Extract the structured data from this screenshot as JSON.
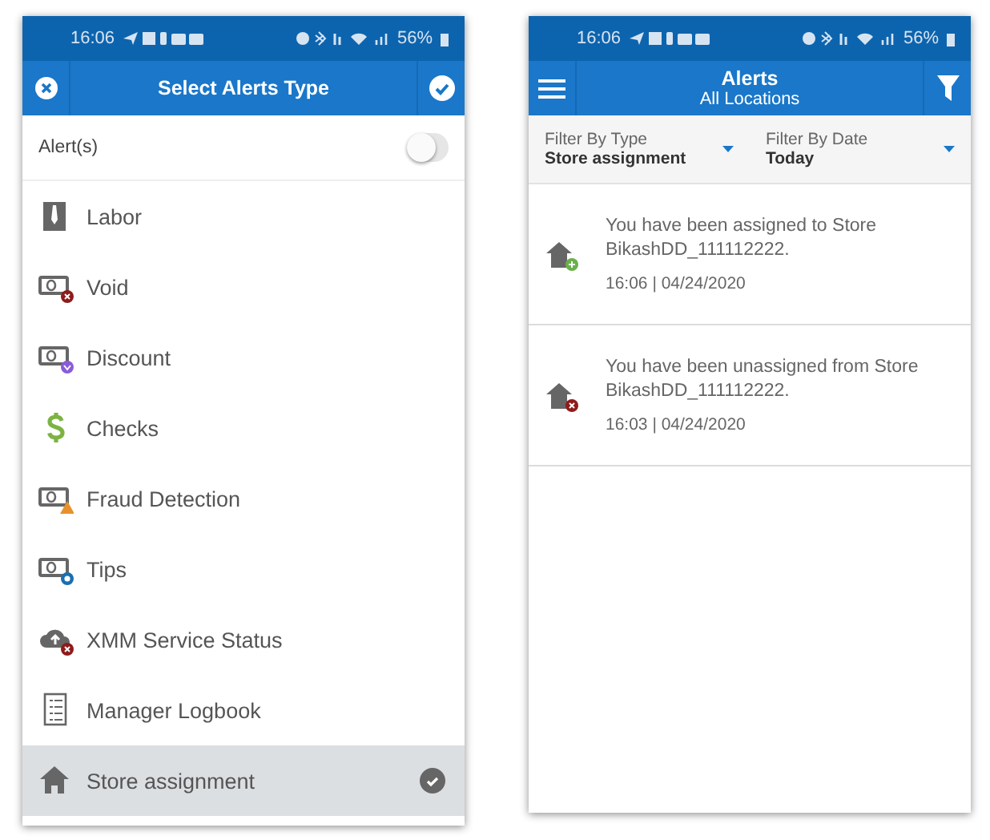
{
  "left_screen": {
    "status_bar": {
      "time": "16:06",
      "battery": "56%"
    },
    "title": "Select Alerts Type",
    "toggle": {
      "label": "Alert(s)",
      "on": false
    },
    "items": [
      {
        "label": "Labor",
        "kind": "tie",
        "selected": false
      },
      {
        "label": "Void",
        "kind": "cash",
        "badge": {
          "kind": "x",
          "color": "#8e1b1b"
        },
        "selected": false
      },
      {
        "label": "Discount",
        "kind": "cash",
        "badge": {
          "kind": "down",
          "color": "#8a5cd8"
        },
        "selected": false
      },
      {
        "label": "Checks",
        "kind": "dollar",
        "selected": false
      },
      {
        "label": "Fraud Detection",
        "kind": "cash",
        "badge": {
          "kind": "warn",
          "color": "#e8912c"
        },
        "selected": false
      },
      {
        "label": "Tips",
        "kind": "cash",
        "badge": {
          "kind": "shield",
          "color": "#1a6fb0"
        },
        "selected": false
      },
      {
        "label": "XMM Service Status",
        "kind": "cloud",
        "badge": {
          "kind": "x",
          "color": "#8e1b1b"
        },
        "selected": false
      },
      {
        "label": "Manager Logbook",
        "kind": "logbook",
        "selected": false
      },
      {
        "label": "Store assignment",
        "kind": "home",
        "selected": true
      }
    ]
  },
  "right_screen": {
    "status_bar": {
      "time": "16:06",
      "battery": "56%"
    },
    "title": "Alerts",
    "subtitle": "All Locations",
    "filters": [
      {
        "label": "Filter By Type",
        "value": "Store assignment"
      },
      {
        "label": "Filter By Date",
        "value": "Today"
      }
    ],
    "alerts": [
      {
        "message": "You have been assigned to Store BikashDD_111112222.",
        "time": "16:06 | 04/24/2020",
        "badge": {
          "kind": "plus",
          "color": "#6ab04c"
        }
      },
      {
        "message": "You have been unassigned from Store BikashDD_111112222.",
        "time": "16:03 | 04/24/2020",
        "badge": {
          "kind": "x",
          "color": "#8e1b1b"
        }
      }
    ]
  }
}
